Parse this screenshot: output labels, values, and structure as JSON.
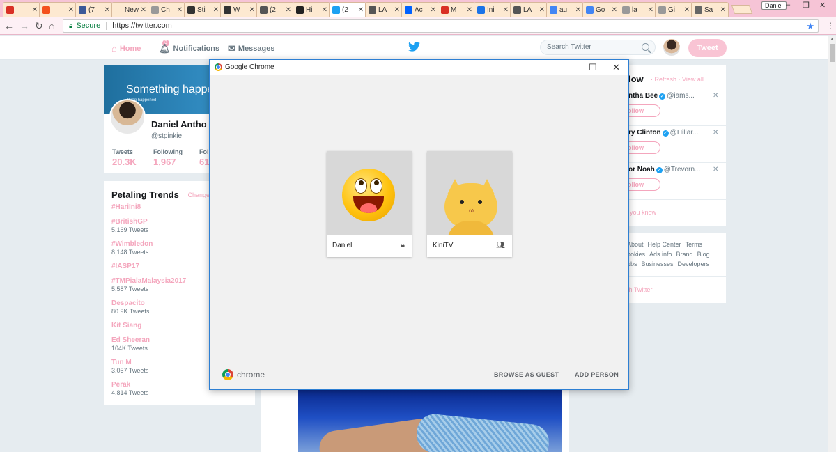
{
  "browser": {
    "tabs": [
      {
        "title": "",
        "icon": "gmail-red-icon",
        "color": "#d93025"
      },
      {
        "title": "",
        "icon": "music-icon",
        "color": "#f4511e"
      },
      {
        "title": "(7",
        "icon": "facebook-icon",
        "color": "#3b5998"
      },
      {
        "title": "New T",
        "icon": "",
        "color": ""
      },
      {
        "title": "Ch",
        "icon": "page-icon",
        "color": "#999999"
      },
      {
        "title": "Sti",
        "icon": "s-logo-icon",
        "color": "#333333"
      },
      {
        "title": "W",
        "icon": "at-icon",
        "color": "#333333"
      },
      {
        "title": "(2",
        "icon": "page-icon",
        "color": "#555555"
      },
      {
        "title": "Hi",
        "icon": "shield-icon",
        "color": "#222222"
      },
      {
        "title": "(2",
        "icon": "twitter-icon",
        "color": "#1da1f2"
      },
      {
        "title": "LA",
        "icon": "globe-icon",
        "color": "#555555"
      },
      {
        "title": "Ac",
        "icon": "dropbox-icon",
        "color": "#0061ff"
      },
      {
        "title": "M",
        "icon": "gmail-icon",
        "color": "#d93025"
      },
      {
        "title": "Ini",
        "icon": "loading-icon",
        "color": "#1a73e8"
      },
      {
        "title": "LA",
        "icon": "globe-icon",
        "color": "#555555"
      },
      {
        "title": "au",
        "icon": "google-icon",
        "color": "#4285f4"
      },
      {
        "title": "Go",
        "icon": "google-icon",
        "color": "#4285f4"
      },
      {
        "title": "la",
        "icon": "loading-icon",
        "color": "#999999"
      },
      {
        "title": "Gi",
        "icon": "loading-icon",
        "color": "#999999"
      },
      {
        "title": "Sa",
        "icon": "image-icon",
        "color": "#666666"
      }
    ],
    "profile_button": "Daniel",
    "secure_label": "Secure",
    "url": "https://twitter.com"
  },
  "twitter": {
    "nav": {
      "home": "Home",
      "notifications": "Notifications",
      "notification_count": "3",
      "messages": "Messages",
      "search_placeholder": "Search Twitter",
      "tweet_button": "Tweet"
    },
    "profile": {
      "banner_text": "Something happe",
      "banner_sub": "thing happened",
      "name": "Daniel Antho",
      "handle": "@stpinkie",
      "stats": [
        {
          "label": "Tweets",
          "value": "20.3K"
        },
        {
          "label": "Following",
          "value": "1,967"
        },
        {
          "label": "Fol",
          "value": "61"
        }
      ]
    },
    "trends": {
      "title": "Petaling Trends",
      "change": "· Change",
      "items": [
        {
          "name": "#HariIni8",
          "count": ""
        },
        {
          "name": "#BritishGP",
          "count": "5,169 Tweets"
        },
        {
          "name": "#Wimbledon",
          "count": "8,148 Tweets"
        },
        {
          "name": "#IASP17",
          "count": ""
        },
        {
          "name": "#TMPialaMalaysia2017",
          "count": "5,587 Tweets"
        },
        {
          "name": "Despacito",
          "count": "80.9K Tweets"
        },
        {
          "name": "Kit Siang",
          "count": ""
        },
        {
          "name": "Ed Sheeran",
          "count": "104K Tweets"
        },
        {
          "name": "Tun M",
          "count": "3,057 Tweets"
        },
        {
          "name": "Perak",
          "count": "4,814 Tweets"
        }
      ]
    },
    "who_to_follow": {
      "title": "low",
      "links": "· Refresh · View all",
      "items": [
        {
          "name": "ntha Bee",
          "handle": "@iams...",
          "button": "ollow"
        },
        {
          "name": "ry Clinton",
          "handle": "@Hillar...",
          "button": "ollow"
        },
        {
          "name": "or Noah",
          "handle": "@Trevorn...",
          "button": "ollow"
        }
      ],
      "find_people": "you know"
    },
    "footer": {
      "line1": [
        "About",
        "Help Center",
        "Terms"
      ],
      "line2": [
        "ookies",
        "Ads info",
        "Brand",
        "Blog"
      ],
      "line3": [
        "obs",
        "Businesses",
        "Developers"
      ],
      "ads": "th Twitter"
    }
  },
  "dialog": {
    "title": "Google Chrome",
    "profiles": [
      {
        "name": "Daniel",
        "status_icon": "lock-icon"
      },
      {
        "name": "KiniTV",
        "status_icon": "supervised-user-icon"
      }
    ],
    "brand": "chrome",
    "browse_as_guest": "BROWSE AS GUEST",
    "add_person": "ADD PERSON"
  }
}
